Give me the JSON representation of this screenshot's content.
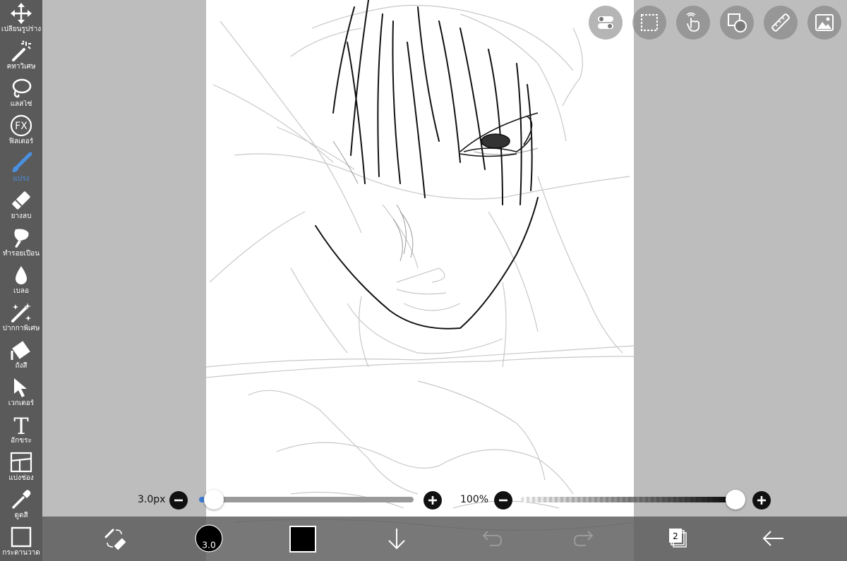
{
  "toolbar": {
    "tools": [
      {
        "label": "เปลี่ยนรูปร่าง",
        "icon": "transform-icon"
      },
      {
        "label": "คทาวิเศษ",
        "icon": "magic-wand-icon"
      },
      {
        "label": "แลสโซ่",
        "icon": "lasso-icon"
      },
      {
        "label": "ฟิลเตอร์",
        "icon": "fx-filter-icon",
        "glyph": "FX"
      },
      {
        "label": "แปรง",
        "icon": "brush-icon",
        "active": true
      },
      {
        "label": "ยางลบ",
        "icon": "eraser-icon"
      },
      {
        "label": "ทำรอยเปื้อน",
        "icon": "smudge-icon"
      },
      {
        "label": "เบลอ",
        "icon": "blur-drop-icon"
      },
      {
        "label": "ปากกาพิเศษ",
        "icon": "special-pen-icon"
      },
      {
        "label": "ถังสี",
        "icon": "bucket-icon"
      },
      {
        "label": "เวกเตอร์",
        "icon": "vector-arrow-icon"
      },
      {
        "label": "อักขระ",
        "icon": "text-icon",
        "glyph": "T"
      },
      {
        "label": "แบ่งช่อง",
        "icon": "frame-divider-icon"
      },
      {
        "label": "ดูดสี",
        "icon": "eyedropper-icon"
      },
      {
        "label": "กระดานวาด",
        "icon": "canvas-icon"
      }
    ],
    "active_color": "#4a90e2"
  },
  "top_buttons": [
    {
      "icon": "toggle-icon"
    },
    {
      "icon": "selection-icon"
    },
    {
      "icon": "hand-icon"
    },
    {
      "icon": "shape-icon"
    },
    {
      "icon": "ruler-icon"
    },
    {
      "icon": "image-icon"
    }
  ],
  "brush_size": {
    "label": "3.0px",
    "value_fraction": 0.03
  },
  "brush_opacity": {
    "label": "100%",
    "value_fraction": 1.0
  },
  "bottom_bar": {
    "brush_size_badge": "3.0",
    "current_color": "#000000",
    "layer_count": "2",
    "items": [
      "swap-tool-icon",
      "brush-size-icon",
      "color-swatch",
      "download-icon",
      "undo-icon",
      "redo-icon",
      "layers-icon",
      "back-arrow-icon"
    ]
  },
  "colors": {
    "sidebar": "#5a5a5a",
    "background": "#bdbdbd",
    "canvas": "#ffffff"
  }
}
